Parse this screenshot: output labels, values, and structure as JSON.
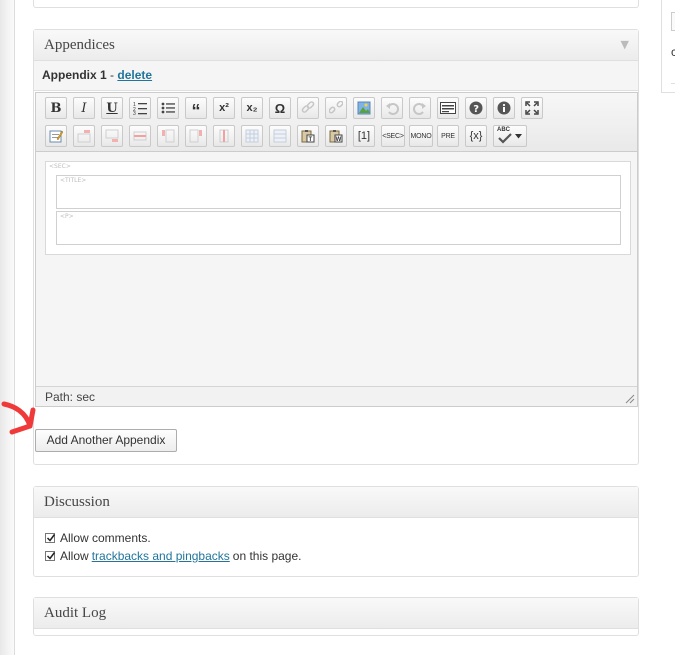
{
  "appendices": {
    "title": "Appendices",
    "toggle_icon": "triangle-down-icon",
    "appendix_label": "Appendix 1",
    "separator": "-",
    "delete_link": "delete",
    "toolbar_text_buttons": {
      "bold": "B",
      "italic": "I",
      "underline": "U",
      "blockquote": "“",
      "superscript": "x²",
      "subscript": "x₂",
      "special_char": "Ω",
      "footnote": "[1]",
      "sec": "<SEC>",
      "mono": "MONO",
      "pre": "PRE",
      "variable": "{x}",
      "spellcheck": "ABC"
    },
    "content_tags": {
      "sec": "<SEC>",
      "title": "<TITLE>",
      "p": "<P>"
    },
    "path": "Path: sec",
    "add_button": "Add Another Appendix"
  },
  "discussion": {
    "title": "Discussion",
    "allow_comments": "Allow comments.",
    "allow_prefix": "Allow",
    "trackbacks_link": "trackbacks and pingbacks",
    "allow_suffix": "on this page."
  },
  "audit_log": {
    "title": "Audit Log"
  },
  "colors": {
    "link": "#21759b",
    "annotation_arrow": "#f03a3a"
  }
}
